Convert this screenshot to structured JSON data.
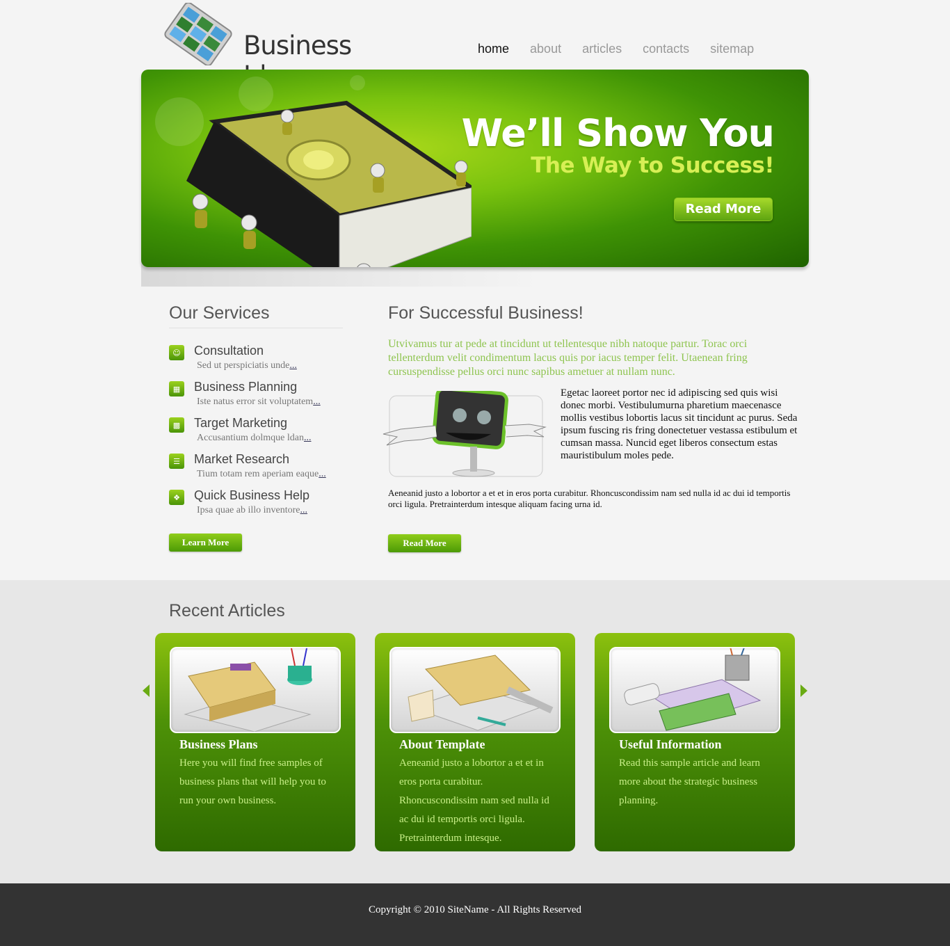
{
  "header": {
    "logo_text": "Business Ideas",
    "nav": [
      "home",
      "about",
      "articles",
      "contacts",
      "sitemap"
    ],
    "active_nav": "home"
  },
  "banner": {
    "title": "We’ll Show You",
    "subtitle": "The Way to Success!",
    "button": "Read More"
  },
  "services": {
    "heading": "Our Services",
    "items": [
      {
        "title": "Consultation",
        "desc": "Sed ut perspiciatis unde",
        "more": "..."
      },
      {
        "title": "Business Planning",
        "desc": "Iste natus error sit voluptatem",
        "more": "..."
      },
      {
        "title": "Target Marketing",
        "desc": "Accusantium dolmque ldan",
        "more": "..."
      },
      {
        "title": "Market Research",
        "desc": "Tium totam rem aperiam eaque",
        "more": "..."
      },
      {
        "title": "Quick Business Help",
        "desc": "Ipsa quae ab illo inventore",
        "more": "..."
      }
    ],
    "button": "Learn More"
  },
  "main": {
    "heading": "For Successful Business!",
    "intro": "Utvivamus tur at pede at tincidunt ut tellentesque nibh natoque partur. Torac orci tellenterdum velit condimentum lacus quis por iacus temper felit. Utaenean fring cursuspendisse pellus orci nunc sapibus ametuer at nullam nunc.",
    "side_text": "Egetac laoreet portor nec id adipiscing sed quis wisi donec morbi. Vestibulumurna pharetium maecenasce mollis vestibus lobortis lacus sit tincidunt ac purus. Seda ipsum fuscing ris fring donectetuer vestassa estibulum et cumsan massa. Nuncid eget liberos consectum estas mauristibulum moles pede.",
    "small_text": "Aeneanid justo a lobortor a et et in eros porta curabitur. Rhoncuscondissim nam sed nulla id ac dui id temportis orci ligula. Pretrainterdum intesque aliquam facing urna id.",
    "button": "Read More"
  },
  "articles": {
    "heading": "Recent Articles",
    "items": [
      {
        "title": "Business Plans",
        "text": "Here you will find free samples of business plans that will help you to run your own business."
      },
      {
        "title": "About Template",
        "text": "Aeneanid justo a lobortor a et et in eros porta curabitur. Rhoncuscondissim nam sed nulla id ac dui id temportis orci ligula. Pretrainterdum intesque."
      },
      {
        "title": "Useful Information",
        "text": "Read this sample article and learn more about the strategic business planning."
      }
    ]
  },
  "footer": {
    "copyright": "Copyright © 2010 SiteName - All Rights Reserved"
  },
  "colors": {
    "accent": "#6aab14",
    "banner_dark": "#1f6300",
    "footer": "#333333"
  }
}
